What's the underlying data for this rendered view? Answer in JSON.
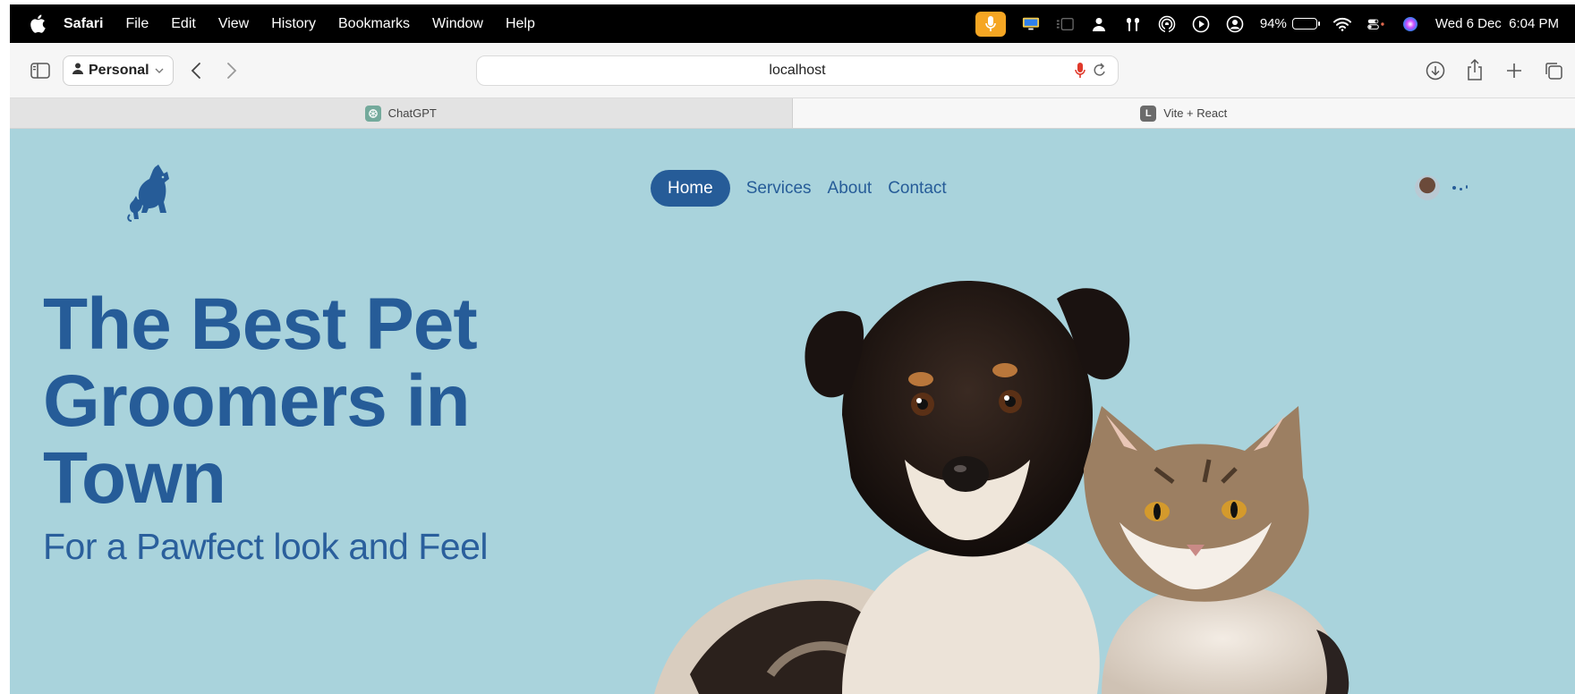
{
  "menubar": {
    "app_name": "Safari",
    "menus": [
      "File",
      "Edit",
      "View",
      "History",
      "Bookmarks",
      "Window",
      "Help"
    ],
    "battery_percent": "94%",
    "battery_level": 0.94,
    "datetime": "Wed 6 Dec  6:04 PM",
    "accent_color": "#f5a623"
  },
  "toolbar": {
    "profile_label": "Personal",
    "url": "localhost"
  },
  "tabs": [
    {
      "label": "ChatGPT",
      "favicon": "chatgpt-icon",
      "active": false
    },
    {
      "label": "Vite + React",
      "favicon": "L",
      "active": true
    }
  ],
  "site": {
    "nav": {
      "home": "Home",
      "services": "Services",
      "about": "About",
      "contact": "Contact"
    },
    "headline": "The Best Pet Groomers in Town",
    "subline": "For a Pawfect look and Feel",
    "colors": {
      "background": "#a9d3dc",
      "primary": "#265c98"
    }
  }
}
